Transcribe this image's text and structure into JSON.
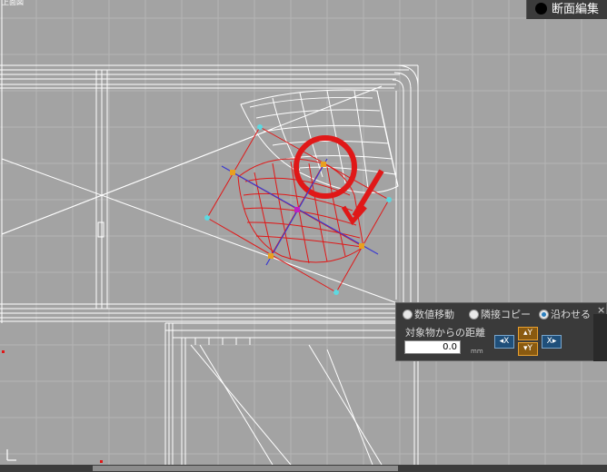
{
  "viewport": {
    "corner_label": "上面図",
    "axis_icon": "axis-indicator-icon",
    "colors": {
      "background": "#a3a3a3",
      "grid": "#b5b5b5",
      "wireframe": "#ffffff",
      "selected": "#e01818",
      "axis": "#3a3ad0",
      "handle": "#5ed8e0",
      "control": "#e8a020"
    }
  },
  "mode": {
    "label": "断面編集",
    "icon": "record-dot-icon"
  },
  "panel": {
    "options": [
      {
        "label": "数値移動",
        "selected": false
      },
      {
        "label": "隣接コピー",
        "selected": false
      },
      {
        "label": "沿わせる",
        "selected": true
      }
    ],
    "distance_label": "対象物からの距離",
    "distance_value": "0.0",
    "unit": "mm",
    "nudge": {
      "x_minus": "◂X",
      "y_plus": "▴Y",
      "y_minus": "▾Y",
      "x_plus": "X▸"
    },
    "close_symbol": "×"
  }
}
